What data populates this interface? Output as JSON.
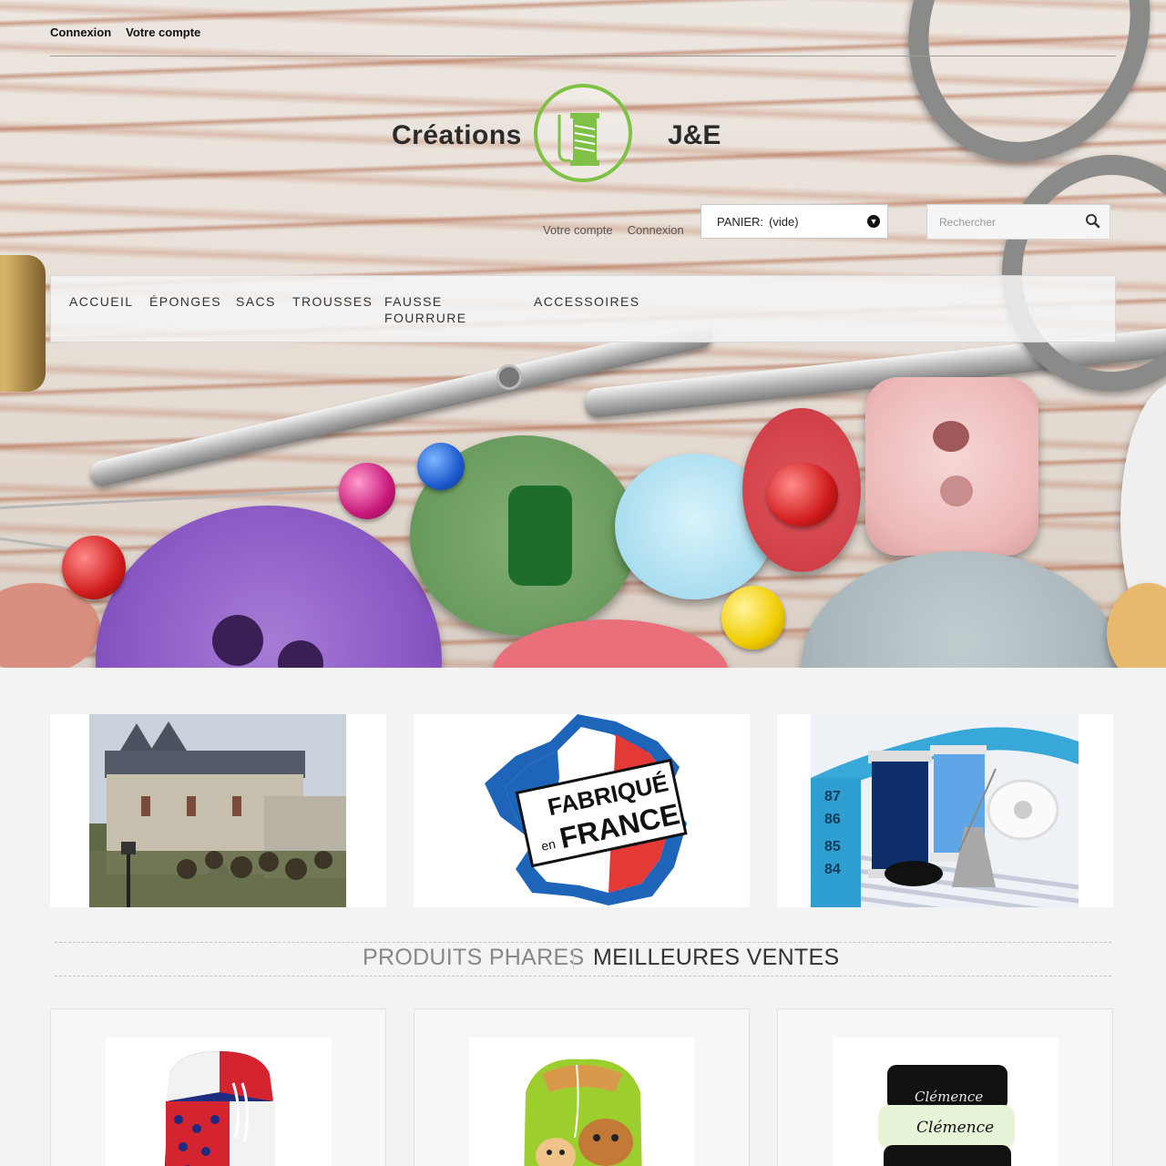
{
  "top_links": {
    "login": "Connexion",
    "account": "Votre compte"
  },
  "logo": {
    "word_left": "Créations",
    "word_right": "J&E",
    "accent": "#7ec144",
    "icon": "thread-spool-icon"
  },
  "header_links": {
    "account": "Votre compte",
    "login": "Connexion"
  },
  "cart": {
    "label": "PANIER:",
    "status": "(vide)",
    "icon": "chevron-down-circle-icon"
  },
  "search": {
    "placeholder": "Rechercher",
    "icon": "search-icon"
  },
  "nav": {
    "items": [
      {
        "label": "ACCUEIL"
      },
      {
        "label": "ÉPONGES"
      },
      {
        "label": "SACS"
      },
      {
        "label": "TROUSSES"
      },
      {
        "label": "FAUSSE\nFOURRURE"
      },
      {
        "label": "ACCESSOIRES"
      }
    ]
  },
  "banners": {
    "fabrique": {
      "line1": "FABRIQUÉ",
      "line2": "en",
      "line3": "FRANCE"
    }
  },
  "tabs": {
    "featured": "PRODUITS PHARES",
    "bestsellers": "MEILLEURES VENTES"
  },
  "products": {
    "towel": {
      "text1": "Clémence",
      "text2": "Clémence"
    }
  }
}
